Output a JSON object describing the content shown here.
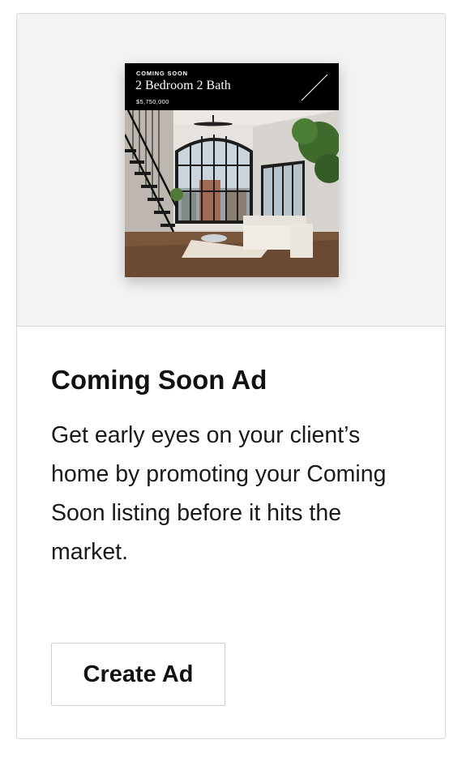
{
  "card": {
    "ad_preview": {
      "tag": "COMING SOON",
      "headline": "2 Bedroom 2 Bath",
      "price": "$5,750,000",
      "decor_icon": "diagonal-slash-icon"
    },
    "title": "Coming Soon Ad",
    "description": "Get early eyes on your client’s home by promoting your Coming Soon listing before it hits the market.",
    "cta_label": "Create Ad"
  }
}
